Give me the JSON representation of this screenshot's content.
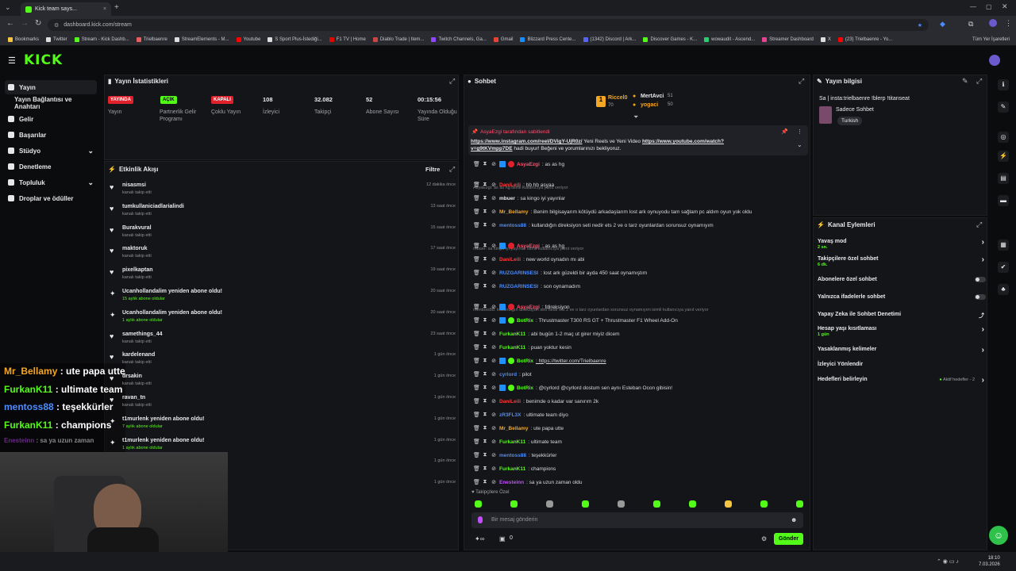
{
  "browser": {
    "tab_title": "Kick team says...",
    "url": "dashboard.kick.com/stream",
    "bookmarks": [
      "Bookmarks",
      "Twitter",
      "Stream - Kick Dashb...",
      "Trielbaenre",
      "StreamElements - M...",
      "Youtube",
      "S Sport Plus-İstediği...",
      "F1 TV | Home",
      "Diablo Trade | Item...",
      "Twitch Channels, Ga...",
      "Gmail",
      "Blizzard Press Cente...",
      "(1342) Discord | Ark...",
      "Discover Games - K...",
      "wowaudit - Ascend...",
      "Streamer Dashboard",
      "X",
      "(23) Trielbaenre - Yo..."
    ],
    "all_bookmarks": "Tüm Yer İşaretleri"
  },
  "brand": {
    "logo": "KICK",
    "accent": "#53fc18"
  },
  "sidebar": {
    "items": [
      {
        "label": "Yayın",
        "icon": "stream-icon"
      },
      {
        "label": "Yayın Bağlantısı ve Anahtarı",
        "icon": ""
      },
      {
        "label": "Gelir",
        "icon": "dollar-icon"
      },
      {
        "label": "Başarılar",
        "icon": "trophy-icon"
      },
      {
        "label": "Stüdyo",
        "icon": "studio-icon"
      },
      {
        "label": "Denetleme",
        "icon": "wrench-icon"
      },
      {
        "label": "Topluluk",
        "icon": "community-icon"
      },
      {
        "label": "Droplar ve ödüller",
        "icon": "gift-icon"
      }
    ]
  },
  "stats": {
    "title": "Yayın İstatistikleri",
    "items": [
      {
        "value": "YAYINDA",
        "label": "Yayın",
        "kind": "badge-red"
      },
      {
        "value": "AÇIK",
        "label": "Partnerlik Gelir Programı",
        "kind": "badge-green"
      },
      {
        "value": "KAPALI",
        "label": "Çoklu Yayın",
        "kind": "badge-red"
      },
      {
        "value": "108",
        "label": "İzleyici"
      },
      {
        "value": "32.082",
        "label": "Takipçi"
      },
      {
        "value": "52",
        "label": "Abone Sayısı"
      },
      {
        "value": "00:15:56",
        "label": "Yayında Olduğu Süre"
      }
    ]
  },
  "activity": {
    "title": "Etkinlik Akışı",
    "filter": "Filtre",
    "events": [
      {
        "name": "nisasmsi",
        "sub": "kanalı takip etti",
        "time": "12 dakika önce",
        "icon": "heart"
      },
      {
        "name": "tumkullaniciadlarialindi",
        "sub": "kanalı takip etti",
        "time": "13 saat önce",
        "icon": "heart"
      },
      {
        "name": "Burakvural",
        "sub": "kanalı takip etti",
        "time": "15 saat önce",
        "icon": "heart"
      },
      {
        "name": "maktoruk",
        "sub": "kanalı takip etti",
        "time": "17 saat önce",
        "icon": "heart"
      },
      {
        "name": "pixelkaptan",
        "sub": "kanalı takip etti",
        "time": "19 saat önce",
        "icon": "heart"
      },
      {
        "name": "Ucanhollandalim yeniden abone oldu!",
        "sub": "15 aylık abone oldular",
        "time": "20 saat önce",
        "icon": "star"
      },
      {
        "name": "Ucanhollandalim yeniden abone oldu!",
        "sub": "1 aylık abone oldular",
        "time": "20 saat önce",
        "icon": "star"
      },
      {
        "name": "samethings_44",
        "sub": "kanalı takip etti",
        "time": "23 saat önce",
        "icon": "heart"
      },
      {
        "name": "kardelenand",
        "sub": "kanalı takip etti",
        "time": "1 gün önce",
        "icon": "heart"
      },
      {
        "name": "drsakin",
        "sub": "kanalı takip etti",
        "time": "1 gün önce",
        "icon": "heart"
      },
      {
        "name": "ravan_tn",
        "sub": "kanalı takip etti",
        "time": "1 gün önce",
        "icon": "heart"
      },
      {
        "name": "t1murlenk yeniden abone oldu!",
        "sub": "7 aylık abone oldular",
        "time": "1 gün önce",
        "icon": "star"
      },
      {
        "name": "t1murlenk yeniden abone oldu!",
        "sub": "1 aylık abone oldular",
        "time": "1 gün önce",
        "icon": "star"
      },
      {
        "name": "",
        "sub": "",
        "time": "1 gün önce",
        "icon": ""
      },
      {
        "name": "",
        "sub": "",
        "time": "1 gün önce",
        "icon": ""
      }
    ]
  },
  "overlay_chat": [
    {
      "user": "Mr_Bellamy",
      "text": " : ute papa utte",
      "color": "#f5a623"
    },
    {
      "user": "FurkanK11",
      "text": " : ultimate team",
      "color": "#53fc18"
    },
    {
      "user": "mentoss88",
      "text": " : teşekkürler",
      "color": "#4a8cff"
    },
    {
      "user": "FurkanK11",
      "text": " : champions",
      "color": "#53fc18"
    },
    {
      "user": "Enesteinn",
      "text": " : sa ya uzun zaman",
      "color": "#c44dff"
    }
  ],
  "chat": {
    "title": "Sohbet",
    "top_gifters": [
      {
        "name": "Riccel0",
        "count": "70",
        "color": "#f5a623"
      },
      {
        "name": "MertAvci",
        "count": "51",
        "color": "#e8e9eb"
      },
      {
        "name": "yogaci",
        "count": "50",
        "color": "#f5a623"
      }
    ],
    "pinned_by": "AsyaEzgi tarafından sabitlendi",
    "pinned_link1": "https://www.instagram.com/reel/DVigY-UjR0z/",
    "pinned_text1": " Yeni Reels ve Yeni Video ",
    "pinned_link2": "https://www.youtube.com/watch?v=g9tKVmpp7DE",
    "pinned_text2": " hadi buyur! Beğeni ve yorumlarınızı bekliyoruz.",
    "messages": [
      {
        "user": "AsyaEzgi",
        "color": "#ff4d6d",
        "text": ": as as hg",
        "type": "msg"
      },
      {
        "user": "",
        "color": "",
        "text": "AsyaEzgi: as as hg isimli kullanıcıya yanıt veriyor",
        "type": "reply"
      },
      {
        "user": "DaniLeili",
        "color": "#ff3b3b",
        "text": ": hb hb asyaa",
        "type": "msg"
      },
      {
        "user": "mbuer",
        "color": "#e8e9eb",
        "text": ": sa kingo iyi yayınlar",
        "type": "msg"
      },
      {
        "user": "Mr_Bellamy",
        "color": "#f5a623",
        "text": ": Benim bilgisayarım kötüydü arkadaşlarım lost ark oynuyodu tam sağlam pc aldım oyun yok oldu",
        "type": "msg"
      },
      {
        "user": "mentoss88",
        "color": "#4a8cff",
        "text": ": kullandığın direksiyon seti nedir ets 2 ve o tarz oyunlardan sorunsuz oynamıyım",
        "type": "msg"
      },
      {
        "user": "",
        "color": "",
        "text": "mbuer: sa kingo iyi yayınlar isimli kullanıcıya yanıt veriyor",
        "type": "reply"
      },
      {
        "user": "AsyaEzgi",
        "color": "#ff4d6d",
        "text": ": as as hg",
        "type": "msg"
      },
      {
        "user": "DaniLeili",
        "color": "#ff3b3b",
        "text": ": new world oynadın mı abi",
        "type": "msg"
      },
      {
        "user": "RUZGARINSESI",
        "color": "#4a8cff",
        "text": ": lost ark güzeldi bir ayda 450 saat oynamıştım",
        "type": "msg"
      },
      {
        "user": "RUZGARINSESI",
        "color": "#4a8cff",
        "text": ": son oynamadım",
        "type": "msg"
      },
      {
        "user": "",
        "color": "",
        "text": "mentoss88: kullandığın direksiyon seti nedir ets 2 ve o tarz oyunlardan sorunsuz oynamıyım isimli kullanıcıya yanıt veriyor",
        "type": "reply"
      },
      {
        "user": "AsyaEzgi",
        "color": "#ff4d6d",
        "text": ": fdireksiyon",
        "type": "msg"
      },
      {
        "user": "BotRix",
        "color": "#53fc18",
        "text": ": Thrustmaster T300 RS GT + Thrustmaster F1 Wheel Add-On",
        "type": "msg"
      },
      {
        "user": "FurkanK11",
        "color": "#53fc18",
        "text": ": abi bugün 1-2 maç ut girer miyiz dicem",
        "type": "msg"
      },
      {
        "user": "FurkanK11",
        "color": "#53fc18",
        "text": ": puan yoktur kesin",
        "type": "msg"
      },
      {
        "user": "BotRix",
        "color": "#53fc18",
        "text": ": https://twitter.com/Trielbaenre",
        "type": "msg"
      },
      {
        "user": "cyrlord",
        "color": "#4a8cff",
        "text": ": pilot",
        "type": "msg"
      },
      {
        "user": "BotRix",
        "color": "#53fc18",
        "text": ": @cyrlord @cyrlord dostum sen aynı Esteban Ocon gibisin!",
        "type": "msg"
      },
      {
        "user": "DaniLeili",
        "color": "#ff3b3b",
        "text": ": benimde o kadar var sanırım 2k",
        "type": "msg"
      },
      {
        "user": "zR3FL3X",
        "color": "#4a8cff",
        "text": ": ultimate team diyo",
        "type": "msg"
      },
      {
        "user": "Mr_Bellamy",
        "color": "#f5a623",
        "text": ": ute papa utte",
        "type": "msg"
      },
      {
        "user": "FurkanK11",
        "color": "#53fc18",
        "text": ": ultimate team",
        "type": "msg"
      },
      {
        "user": "mentoss88",
        "color": "#4a8cff",
        "text": ": teşekkürler",
        "type": "msg"
      },
      {
        "user": "FurkanK11",
        "color": "#53fc18",
        "text": ": champions",
        "type": "msg"
      },
      {
        "user": "Enesteinn",
        "color": "#c44dff",
        "text": ": sa ya uzun zaman oldu",
        "type": "msg"
      }
    ],
    "followers_only": "Takipçilere Özel",
    "placeholder": "Bir mesaj gönderin",
    "counter": "0",
    "send": "Gönder"
  },
  "stream_info": {
    "title": "Yayın bilgisi",
    "stream_title": "Sa | insta:trielbaenre !blerp !titanseat",
    "category": "Sadece Sohbet",
    "tag": "Turkish"
  },
  "channel_actions": {
    "title": "Kanal Eylemleri",
    "rows": [
      {
        "label": "Yavaş mod",
        "sub": "2 sn.",
        "control": "chevron"
      },
      {
        "label": "Takipçilere özel sohbet",
        "sub": "6 dk.",
        "control": "chevron"
      },
      {
        "label": "Abonelere özel sohbet",
        "sub": "",
        "control": "toggle"
      },
      {
        "label": "Yalnızca ifadelerle sohbet",
        "sub": "",
        "control": "toggle"
      },
      {
        "label": "Yapay Zeka ile Sohbet Denetimi",
        "sub": "",
        "control": "external"
      },
      {
        "label": "Hesap yaşı kısıtlaması",
        "sub": "1 gün",
        "control": "chevron"
      },
      {
        "label": "Yasaklanmış kelimeler",
        "sub": "",
        "control": "chevron"
      },
      {
        "label": "İzleyici Yönlendir",
        "sub": "",
        "control": ""
      },
      {
        "label": "Hedefleri belirleyin",
        "sub": "",
        "control": "goal"
      }
    ],
    "goal_status": "Aktif hedefler - 2"
  },
  "taskbar": {
    "time": "18:10",
    "date": "7.03.2026"
  }
}
